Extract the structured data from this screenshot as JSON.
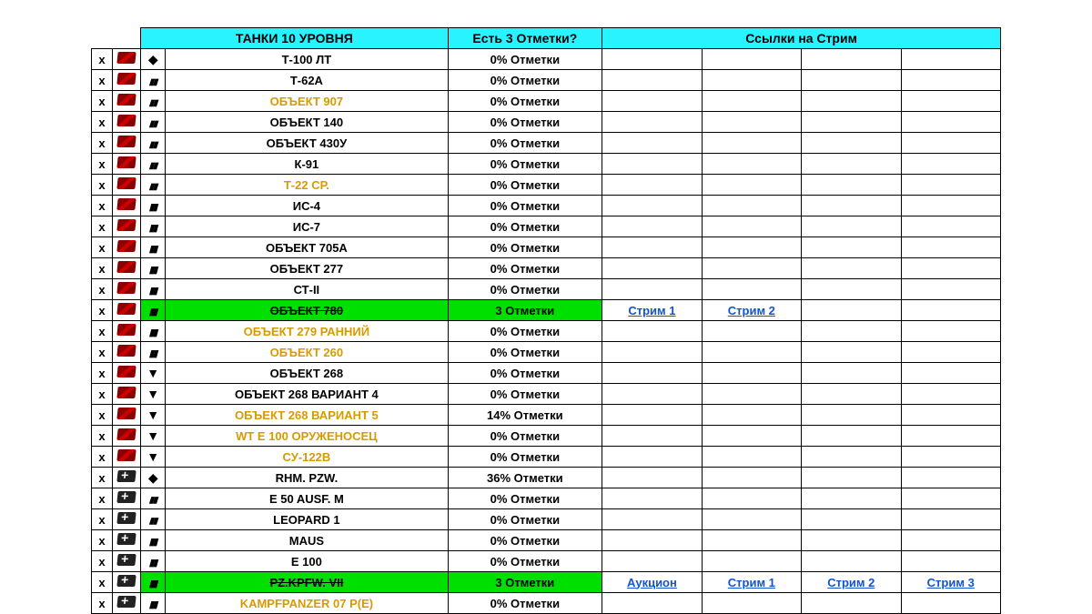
{
  "headers": {
    "tanks": "ТАНКИ 10 УРОВНЯ",
    "marks": "Есть 3 Отметки?",
    "links": "Ссылки на Стрим"
  },
  "linkTexts": {
    "stream1": "Стрим 1",
    "stream2": "Стрим 2",
    "stream3": "Стрим 3",
    "auction": "Аукцион"
  },
  "rows": [
    {
      "x": "x",
      "flag": "r",
      "cls": "lt",
      "name": "Т-100 ЛТ",
      "gold": false,
      "marks": "0% Отметки",
      "green": false,
      "strike": false,
      "links": []
    },
    {
      "x": "x",
      "flag": "r",
      "cls": "mt",
      "name": "Т-62А",
      "gold": false,
      "marks": "0% Отметки",
      "green": false,
      "strike": false,
      "links": []
    },
    {
      "x": "x",
      "flag": "r",
      "cls": "mt",
      "name": "ОБЪЕКТ 907",
      "gold": true,
      "marks": "0% Отметки",
      "green": false,
      "strike": false,
      "links": []
    },
    {
      "x": "x",
      "flag": "r",
      "cls": "mt",
      "name": "ОБЪЕКТ 140",
      "gold": false,
      "marks": "0% Отметки",
      "green": false,
      "strike": false,
      "links": []
    },
    {
      "x": "x",
      "flag": "r",
      "cls": "mt",
      "name": "ОБЪЕКТ 430У",
      "gold": false,
      "marks": "0% Отметки",
      "green": false,
      "strike": false,
      "links": []
    },
    {
      "x": "x",
      "flag": "r",
      "cls": "mt",
      "name": "К-91",
      "gold": false,
      "marks": "0% Отметки",
      "green": false,
      "strike": false,
      "links": []
    },
    {
      "x": "x",
      "flag": "r",
      "cls": "mt",
      "name": "Т-22 СР.",
      "gold": true,
      "marks": "0% Отметки",
      "green": false,
      "strike": false,
      "links": []
    },
    {
      "x": "x",
      "flag": "r",
      "cls": "ht",
      "name": "ИС-4",
      "gold": false,
      "marks": "0% Отметки",
      "green": false,
      "strike": false,
      "links": []
    },
    {
      "x": "x",
      "flag": "r",
      "cls": "ht",
      "name": "ИС-7",
      "gold": false,
      "marks": "0% Отметки",
      "green": false,
      "strike": false,
      "links": []
    },
    {
      "x": "x",
      "flag": "r",
      "cls": "ht",
      "name": "ОБЪЕКТ 705А",
      "gold": false,
      "marks": "0% Отметки",
      "green": false,
      "strike": false,
      "links": []
    },
    {
      "x": "x",
      "flag": "r",
      "cls": "ht",
      "name": "ОБЪЕКТ 277",
      "gold": false,
      "marks": "0% Отметки",
      "green": false,
      "strike": false,
      "links": []
    },
    {
      "x": "x",
      "flag": "r",
      "cls": "ht",
      "name": "СТ-II",
      "gold": false,
      "marks": "0% Отметки",
      "green": false,
      "strike": false,
      "links": []
    },
    {
      "x": "x",
      "flag": "r",
      "cls": "ht",
      "name": "ОБЪЕКТ 780",
      "gold": false,
      "marks": "3 Отметки",
      "green": true,
      "strike": true,
      "links": [
        "stream1",
        "stream2"
      ]
    },
    {
      "x": "x",
      "flag": "r",
      "cls": "ht",
      "name": "ОБЪЕКТ 279 РАННИЙ",
      "gold": true,
      "marks": "0% Отметки",
      "green": false,
      "strike": false,
      "links": []
    },
    {
      "x": "x",
      "flag": "r",
      "cls": "ht",
      "name": "ОБЪЕКТ 260",
      "gold": true,
      "marks": "0% Отметки",
      "green": false,
      "strike": false,
      "links": []
    },
    {
      "x": "x",
      "flag": "r",
      "cls": "td",
      "name": "ОБЪЕКТ 268",
      "gold": false,
      "marks": "0% Отметки",
      "green": false,
      "strike": false,
      "links": []
    },
    {
      "x": "x",
      "flag": "r",
      "cls": "td",
      "name": "ОБЪЕКТ 268 ВАРИАНТ 4",
      "gold": false,
      "marks": "0% Отметки",
      "green": false,
      "strike": false,
      "links": []
    },
    {
      "x": "x",
      "flag": "r",
      "cls": "td",
      "name": "ОБЪЕКТ 268 ВАРИАНТ 5",
      "gold": true,
      "marks": "14% Отметки",
      "green": false,
      "strike": false,
      "links": []
    },
    {
      "x": "x",
      "flag": "r",
      "cls": "td",
      "name": "WT E 100 ОРУЖЕНОСЕЦ",
      "gold": true,
      "marks": "0% Отметки",
      "green": false,
      "strike": false,
      "links": []
    },
    {
      "x": "x",
      "flag": "r",
      "cls": "td",
      "name": "СУ-122В",
      "gold": true,
      "marks": "0% Отметки",
      "green": false,
      "strike": false,
      "links": []
    },
    {
      "x": "x",
      "flag": "g",
      "cls": "lt",
      "name": "RHM. PZW.",
      "gold": false,
      "marks": "36% Отметки",
      "green": false,
      "strike": false,
      "links": []
    },
    {
      "x": "x",
      "flag": "g",
      "cls": "mt",
      "name": "E 50 AUSF. M",
      "gold": false,
      "marks": "0% Отметки",
      "green": false,
      "strike": false,
      "links": []
    },
    {
      "x": "x",
      "flag": "g",
      "cls": "mt",
      "name": "LEOPARD 1",
      "gold": false,
      "marks": "0% Отметки",
      "green": false,
      "strike": false,
      "links": []
    },
    {
      "x": "x",
      "flag": "g",
      "cls": "ht",
      "name": "MAUS",
      "gold": false,
      "marks": "0% Отметки",
      "green": false,
      "strike": false,
      "links": []
    },
    {
      "x": "x",
      "flag": "g",
      "cls": "ht",
      "name": "E 100",
      "gold": false,
      "marks": "0% Отметки",
      "green": false,
      "strike": false,
      "links": []
    },
    {
      "x": "x",
      "flag": "g",
      "cls": "ht",
      "name": "PZ.KPFW. VII",
      "gold": false,
      "marks": "3 Отметки",
      "green": true,
      "strike": true,
      "links": [
        "auction",
        "stream1",
        "stream2",
        "stream3"
      ]
    },
    {
      "x": "x",
      "flag": "g",
      "cls": "ht",
      "name": "KAMPFPANZER 07 P(E)",
      "gold": true,
      "marks": "0% Отметки",
      "green": false,
      "strike": false,
      "links": []
    }
  ],
  "classIcons": {
    "lt": "◆",
    "mt": "⧫",
    "ht": "⧫",
    "td": "▼"
  }
}
